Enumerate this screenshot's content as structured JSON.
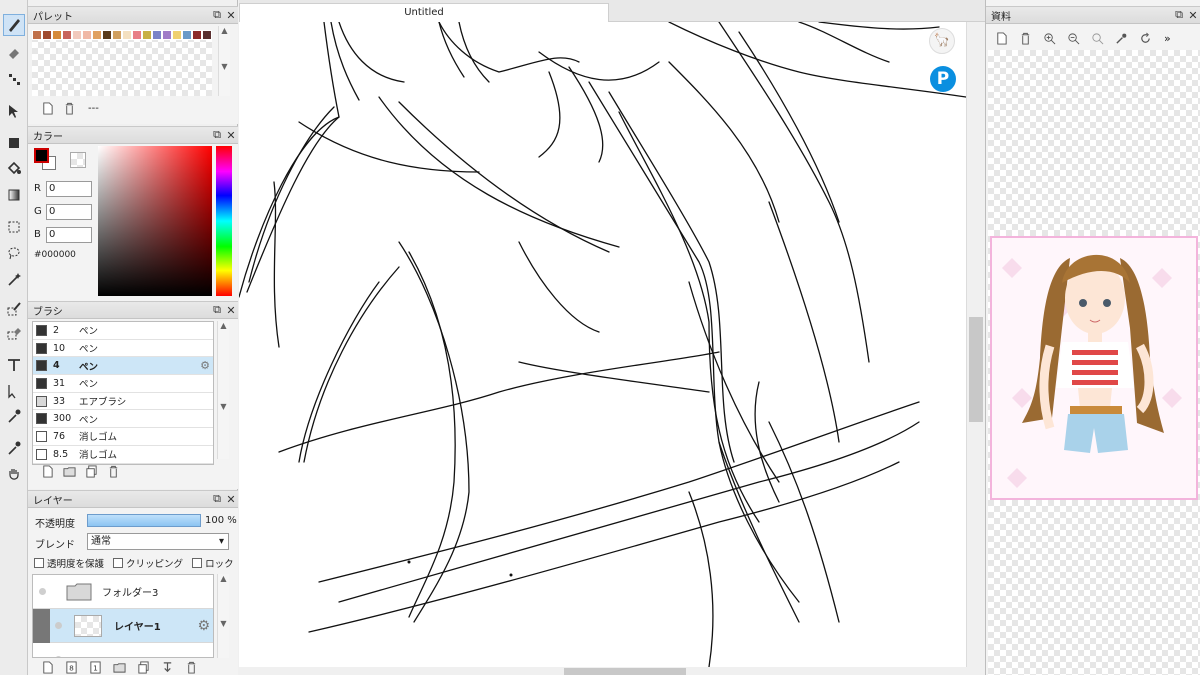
{
  "tab": {
    "title": "Untitled"
  },
  "toolbar": {
    "tools": [
      "pen-tool",
      "eraser-tool",
      "dot-tool",
      "move-tool",
      "rect-fill-tool",
      "bucket-tool",
      "gradient-tool",
      "rect-select-tool",
      "lasso-tool",
      "magic-wand-tool",
      "select-pen-tool",
      "select-eraser-tool",
      "text-tool",
      "operation-tool",
      "eyedropper-tool",
      "eyedropper-tool-2",
      "hand-tool"
    ]
  },
  "palette": {
    "title": "パレット",
    "swatches": [
      "#c0704a",
      "#a04a2e",
      "#d58a3a",
      "#c8645c",
      "#f2c9bd",
      "#f0b8a6",
      "#e0a060",
      "#5a3a1a",
      "#d0a060",
      "#f4e0c0",
      "#e87f86",
      "#c8b044",
      "#7c84c8",
      "#a07cc8",
      "#f0d070",
      "#6a9ac8",
      "#8c2b2b",
      "#5a3030"
    ],
    "status": "---"
  },
  "color": {
    "title": "カラー",
    "r_label": "R",
    "r_value": "0",
    "g_label": "G",
    "g_value": "0",
    "b_label": "B",
    "b_value": "0",
    "hex": "#000000"
  },
  "brush": {
    "title": "ブラシ",
    "items": [
      {
        "size": "2",
        "name": "ペン",
        "swatch": "#333333"
      },
      {
        "size": "10",
        "name": "ペン",
        "swatch": "#333333"
      },
      {
        "size": "4",
        "name": "ペン",
        "swatch": "#333333"
      },
      {
        "size": "31",
        "name": "ペン",
        "swatch": "#333333"
      },
      {
        "size": "33",
        "name": "エアブラシ",
        "swatch": "#d8d8d8"
      },
      {
        "size": "300",
        "name": "ペン",
        "swatch": "#333333"
      },
      {
        "size": "76",
        "name": "消しゴム",
        "swatch": "#ffffff"
      },
      {
        "size": "8.5",
        "name": "消しゴム",
        "swatch": "#ffffff"
      }
    ],
    "selected_index": 2
  },
  "layer": {
    "title": "レイヤー",
    "opacity_label": "不透明度",
    "opacity_value": "100 %",
    "opacity": 1.0,
    "blend_label": "ブレンド",
    "blend_value": "通常",
    "protect_label": "透明度を保護",
    "clipping_label": "クリッピング",
    "lock_label": "ロック",
    "items": [
      {
        "name": "フォルダー3",
        "type": "folder"
      },
      {
        "name": "レイヤー1",
        "type": "layer"
      }
    ]
  },
  "reference": {
    "title": "資料"
  },
  "colors": {
    "selection": "#cde6f7",
    "accent": "#0a8fe0"
  }
}
